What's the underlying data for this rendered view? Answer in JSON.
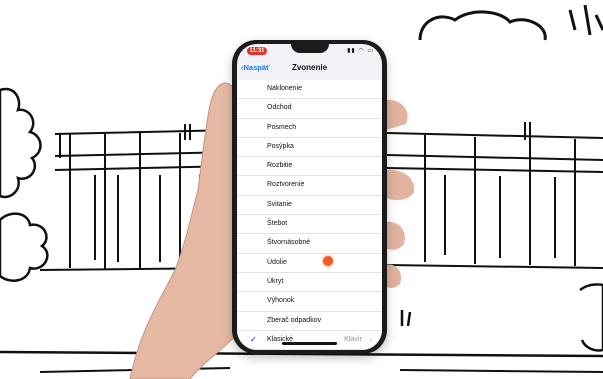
{
  "status": {
    "time": "11:31"
  },
  "nav": {
    "back_label": "Naspäť",
    "title": "Zvonenie"
  },
  "ringtones": [
    {
      "label": "Naklonenie"
    },
    {
      "label": "Odchod"
    },
    {
      "label": "Posmech"
    },
    {
      "label": "Posýpka"
    },
    {
      "label": "Rozbitie"
    },
    {
      "label": "Roztvorenie"
    },
    {
      "label": "Svitanie"
    },
    {
      "label": "Štebot"
    },
    {
      "label": "Štvornásobné"
    },
    {
      "label": "Údolie"
    },
    {
      "label": "Úkryt"
    },
    {
      "label": "Výhonok"
    },
    {
      "label": "Zberač odpadkov"
    }
  ],
  "classic": {
    "label": "Klasické",
    "value": "Klavír",
    "selected": true
  },
  "icons": {
    "back": "chevron-left-icon",
    "check": "checkmark-icon",
    "chevron": "chevron-right-icon",
    "tap": "tap-indicator-icon"
  },
  "colors": {
    "accent": "#1f7ae8",
    "tap_dot": "#ef5b25",
    "status_pill": "#e0342b"
  }
}
